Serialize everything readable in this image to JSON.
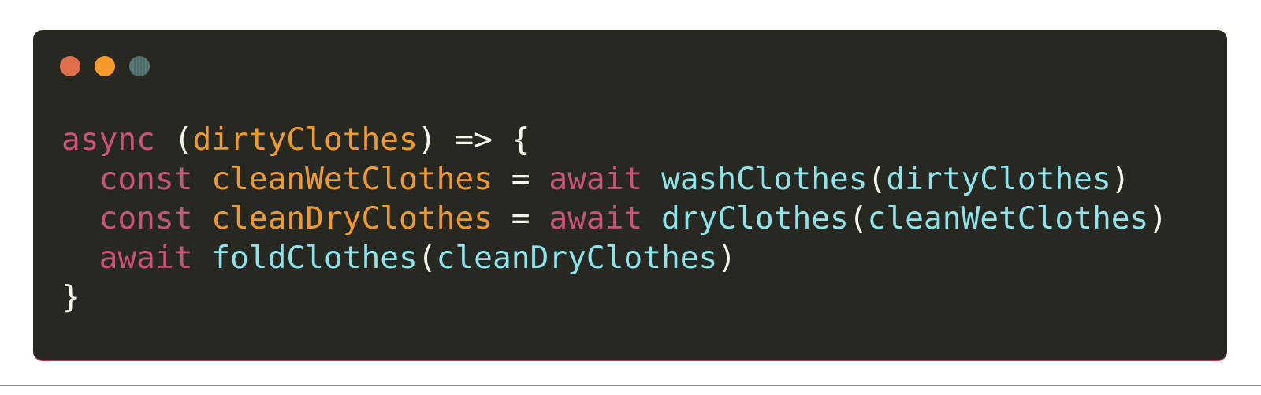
{
  "window": {
    "controls": [
      {
        "name": "close",
        "color": "#e06f4c"
      },
      {
        "name": "minimize",
        "color": "#f59a2b"
      },
      {
        "name": "zoom",
        "color": "#4a6a66"
      }
    ]
  },
  "colors": {
    "background": "#272822",
    "keyword": "#c95478",
    "parameter": "#f19a2c",
    "function": "#8fe3ea",
    "punctuation": "#f6f6ee"
  },
  "code": {
    "lines": [
      [
        {
          "t": "async",
          "k": "keyword"
        },
        {
          "t": " (",
          "k": "punctuation"
        },
        {
          "t": "dirtyClothes",
          "k": "parameter"
        },
        {
          "t": ") => {",
          "k": "punctuation"
        }
      ],
      [
        {
          "t": "  ",
          "k": "punctuation"
        },
        {
          "t": "const",
          "k": "keyword"
        },
        {
          "t": " ",
          "k": "punctuation"
        },
        {
          "t": "cleanWetClothes",
          "k": "parameter"
        },
        {
          "t": " = ",
          "k": "punctuation"
        },
        {
          "t": "await",
          "k": "keyword"
        },
        {
          "t": " ",
          "k": "punctuation"
        },
        {
          "t": "washClothes",
          "k": "function"
        },
        {
          "t": "(",
          "k": "punctuation"
        },
        {
          "t": "dirtyClothes",
          "k": "function"
        },
        {
          "t": ")",
          "k": "punctuation"
        }
      ],
      [
        {
          "t": "  ",
          "k": "punctuation"
        },
        {
          "t": "const",
          "k": "keyword"
        },
        {
          "t": " ",
          "k": "punctuation"
        },
        {
          "t": "cleanDryClothes",
          "k": "parameter"
        },
        {
          "t": " = ",
          "k": "punctuation"
        },
        {
          "t": "await",
          "k": "keyword"
        },
        {
          "t": " ",
          "k": "punctuation"
        },
        {
          "t": "dryClothes",
          "k": "function"
        },
        {
          "t": "(",
          "k": "punctuation"
        },
        {
          "t": "cleanWetClothes",
          "k": "function"
        },
        {
          "t": ")",
          "k": "punctuation"
        }
      ],
      [
        {
          "t": "  ",
          "k": "punctuation"
        },
        {
          "t": "await",
          "k": "keyword"
        },
        {
          "t": " ",
          "k": "punctuation"
        },
        {
          "t": "foldClothes",
          "k": "function"
        },
        {
          "t": "(",
          "k": "punctuation"
        },
        {
          "t": "cleanDryClothes",
          "k": "function"
        },
        {
          "t": ")",
          "k": "punctuation"
        }
      ],
      [
        {
          "t": "}",
          "k": "punctuation"
        }
      ]
    ]
  }
}
